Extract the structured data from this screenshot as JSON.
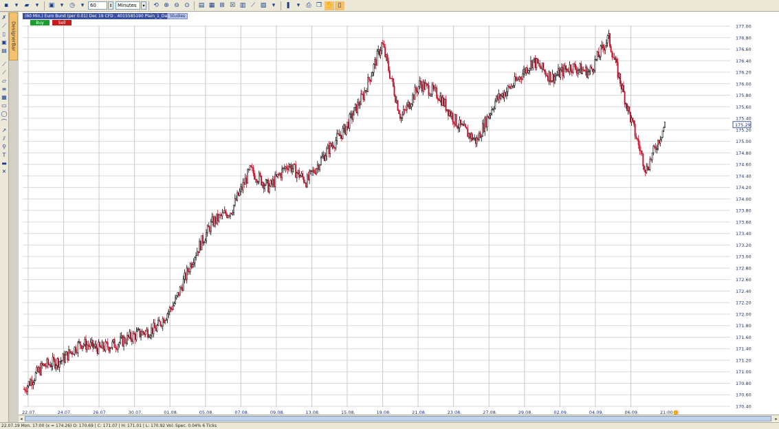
{
  "toolbar": {
    "period_value": "60",
    "period_unit": "Minutes"
  },
  "designer_tab": "DesignerBar",
  "chart": {
    "header": "(60 Min.) Euro Bund (per 0.01) Dec 19 CFD . 4015585190 Plain_1_Day",
    "studies_label": "Studies",
    "buy_label": "Buy",
    "sell_label": "Sell",
    "current_price_label": "175.29",
    "time_label": "21:00"
  },
  "status": {
    "text": "22.07.19 Mon. 17:00 (x = 174.26)  O: 170.69 | C: 171.07 | H: 171.01 | L: 170.92  Vol: Spec. 0.04% 6 Ticks"
  },
  "colors": {
    "up_candle": "#000000",
    "down_candle": "#c0112b",
    "header_bg": "#3a4fa0",
    "grid": "#d9d9d9",
    "vertical_grid": "#c8c8c8",
    "axis_text": "#1a2d7a"
  },
  "chart_data": {
    "type": "candlestick",
    "x_axis_labels": [
      "22.07.",
      "24.07.",
      "26.07.",
      "30.07.",
      "01.08.",
      "05.08.",
      "07.08.",
      "09.08.",
      "13.08.",
      "15.08.",
      "19.08.",
      "21.08.",
      "23.08.",
      "27.08.",
      "29.08.",
      "02.09.",
      "04.09.",
      "06.09.",
      "21:00"
    ],
    "y_axis_labels": [
      "177.00",
      "176.80",
      "176.60",
      "176.40",
      "176.20",
      "176.00",
      "175.80",
      "175.60",
      "175.40",
      "175.20",
      "175.00",
      "174.80",
      "174.60",
      "174.40",
      "174.20",
      "174.00",
      "173.80",
      "173.60",
      "173.40",
      "173.20",
      "173.00",
      "172.80",
      "172.60",
      "172.40",
      "172.20",
      "172.00",
      "171.80",
      "171.60",
      "171.40",
      "171.20",
      "171.00",
      "170.80",
      "170.60",
      "170.40"
    ],
    "ylim": [
      170.4,
      177.0
    ],
    "current_price": 175.29,
    "approx_close_path": [
      [
        "22.07.",
        170.7
      ],
      [
        "23.07.",
        171.1
      ],
      [
        "24.07.",
        171.2
      ],
      [
        "25.07.",
        171.5
      ],
      [
        "26.07.",
        171.4
      ],
      [
        "29.07.",
        171.5
      ],
      [
        "30.07.",
        171.65
      ],
      [
        "31.07.",
        171.75
      ],
      [
        "01.08.",
        172.2
      ],
      [
        "02.08.",
        173.0
      ],
      [
        "05.08.",
        173.6
      ],
      [
        "06.08.",
        173.8
      ],
      [
        "07.08.",
        174.5
      ],
      [
        "08.08.",
        174.2
      ],
      [
        "09.08.",
        174.6
      ],
      [
        "12.08.",
        174.3
      ],
      [
        "13.08.",
        174.8
      ],
      [
        "14.08.",
        175.2
      ],
      [
        "15.08.",
        175.8
      ],
      [
        "16.08.",
        176.7
      ],
      [
        "19.08.",
        175.4
      ],
      [
        "20.08.",
        176.0
      ],
      [
        "21.08.",
        175.8
      ],
      [
        "22.08.",
        175.3
      ],
      [
        "23.08.",
        175.0
      ],
      [
        "26.08.",
        175.7
      ],
      [
        "27.08.",
        176.0
      ],
      [
        "28.08.",
        176.4
      ],
      [
        "29.08.",
        176.1
      ],
      [
        "30.08.",
        176.3
      ],
      [
        "02.09.",
        176.2
      ],
      [
        "03.09.",
        176.8
      ],
      [
        "04.09.",
        175.6
      ],
      [
        "05.09.",
        174.5
      ],
      [
        "06.09.",
        175.29
      ]
    ]
  }
}
